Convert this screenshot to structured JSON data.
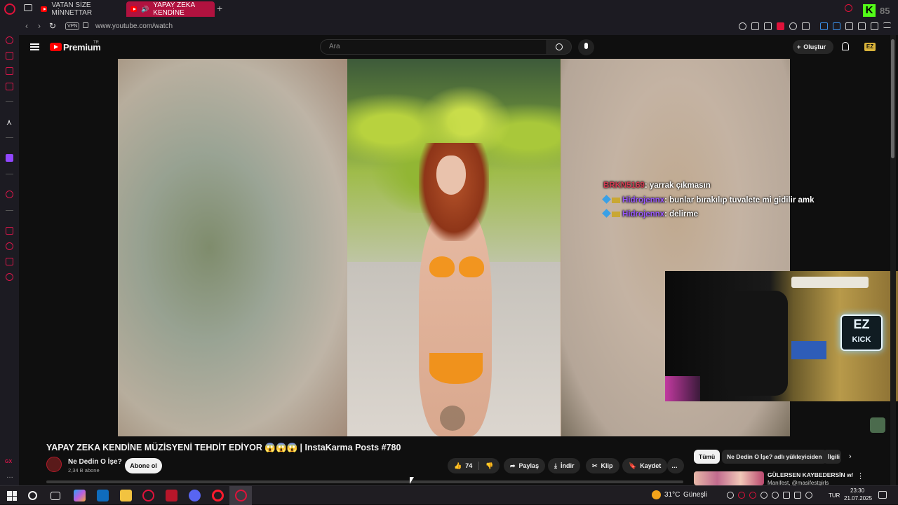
{
  "browser": {
    "tabs": [
      {
        "label": "VATAN SİZE MİNNETTAR",
        "active": false
      },
      {
        "label": "YAPAY ZEKA KENDİNE",
        "active": true
      }
    ],
    "new_tab_symbol": "+",
    "corner_badge": "85",
    "vpn_label": "VPN",
    "url": "www.youtube.com/watch",
    "accent_color": "#e0123a"
  },
  "youtube": {
    "logo_text": "Premium",
    "region": "TR",
    "search_placeholder": "Ara",
    "create_label": "Oluştur",
    "avatar_text": "EZ",
    "video_title": "YAPAY ZEKA KENDİNE MÜZİSYENİ TEHDİT EDİYOR 😱😱😱 | InstaKarma Posts #780",
    "channel_name": "Ne Dedin O İşe?",
    "subscriber_count": "2,34 B abone",
    "subscribe_label": "Abone ol",
    "like_count": "74",
    "share_label": "Paylaş",
    "download_label": "İndir",
    "clip_label": "Klip",
    "save_label": "Kaydet",
    "more_label": "…",
    "chips": [
      "Tümü",
      "Ne Dedin O İşe? adlı yükleyiciden",
      "İlgili"
    ],
    "rec_title": "GÜLERSEN KAYBEDERSİN w/",
    "rec_sub": "Manifest, @m​asifestgirls",
    "rec_menu": "⋮"
  },
  "stream_overlay": {
    "chat": [
      {
        "user": "BRKN5169",
        "message": ": yarrak çıkmasın",
        "user_color": "#d23c52",
        "badges": false
      },
      {
        "user": "Hidrojennx",
        "message": ": bunlar bırakılıp tuvalete mi gidilir amk",
        "user_color": "#9b59ff",
        "badges": true
      },
      {
        "user": "Hidrojennx",
        "message": ": delirme",
        "user_color": "#9b59ff",
        "badges": true
      }
    ],
    "webcam_sign_top": "EZ",
    "webcam_sign_bottom": "KICK"
  },
  "taskbar": {
    "weather_temp": "31°C",
    "weather_desc": "Güneşli",
    "language": "TUR",
    "time": "23:30",
    "date": "21.07.2025"
  },
  "sidebar": {
    "bottom_label": "GX"
  }
}
